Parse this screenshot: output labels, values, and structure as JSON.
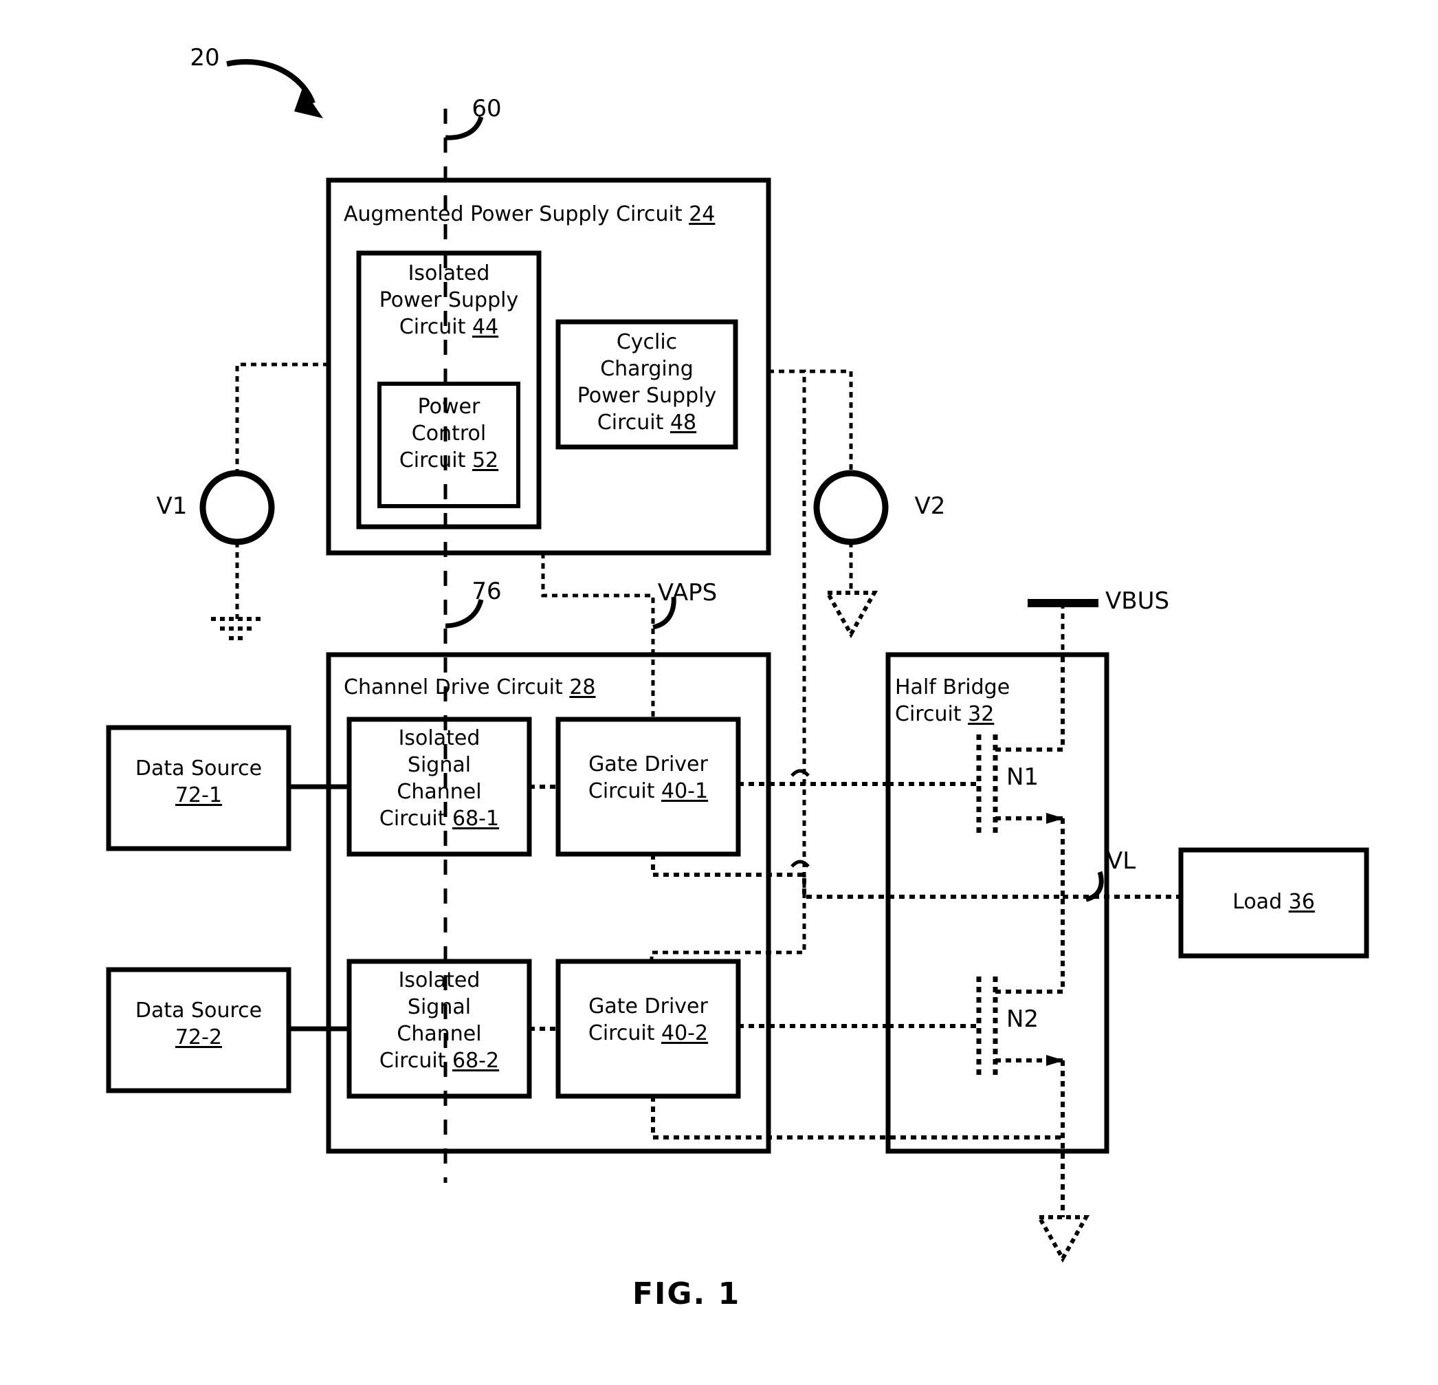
{
  "figure": {
    "caption": "FIG. 1",
    "system_ref": "20",
    "isolation_barrier_top_ref": "60",
    "isolation_barrier_bottom_ref": "76"
  },
  "blocks": {
    "augmented_power_supply": {
      "title": "Augmented Power Supply Circuit",
      "ref": "24"
    },
    "isolated_power_supply": {
      "line1": "Isolated",
      "line2": "Power Supply",
      "line3": "Circuit",
      "ref": "44"
    },
    "power_control": {
      "line1": "Power",
      "line2": "Control",
      "line3": "Circuit",
      "ref": "52"
    },
    "cyclic_charging": {
      "line1": "Cyclic",
      "line2": "Charging",
      "line3": "Power Supply",
      "line4": "Circuit",
      "ref": "48"
    },
    "channel_drive": {
      "title": "Channel Drive Circuit",
      "ref": "28"
    },
    "isolated_signal_channel_1": {
      "line1": "Isolated",
      "line2": "Signal",
      "line3": "Channel",
      "line4": "Circuit",
      "ref": "68-1"
    },
    "isolated_signal_channel_2": {
      "line1": "Isolated",
      "line2": "Signal",
      "line3": "Channel",
      "line4": "Circuit",
      "ref": "68-2"
    },
    "gate_driver_1": {
      "line1": "Gate Driver",
      "line2": "Circuit",
      "ref": "40-1"
    },
    "gate_driver_2": {
      "line1": "Gate Driver",
      "line2": "Circuit",
      "ref": "40-2"
    },
    "data_source_1": {
      "line1": "Data Source",
      "ref": "72-1"
    },
    "data_source_2": {
      "line1": "Data Source",
      "ref": "72-2"
    },
    "half_bridge": {
      "line1": "Half Bridge",
      "line2": "Circuit",
      "ref": "32"
    },
    "load": {
      "line1": "Load",
      "ref": "36"
    }
  },
  "signals": {
    "v1": "V1",
    "v2": "V2",
    "vaps": "VAPS",
    "vbus": "VBUS",
    "vl": "VL",
    "n1": "N1",
    "n2": "N2"
  },
  "icons": {
    "earth_ground": "earth-ground-icon",
    "signal_ground": "signal-ground-icon",
    "source_circle": "voltage-source-icon",
    "mosfet": "n-mosfet-icon",
    "curved_leader": "leader-line-icon",
    "curved_arrow": "curved-arrow-icon"
  },
  "colors": {
    "line": "#000000",
    "background": "#ffffff"
  }
}
